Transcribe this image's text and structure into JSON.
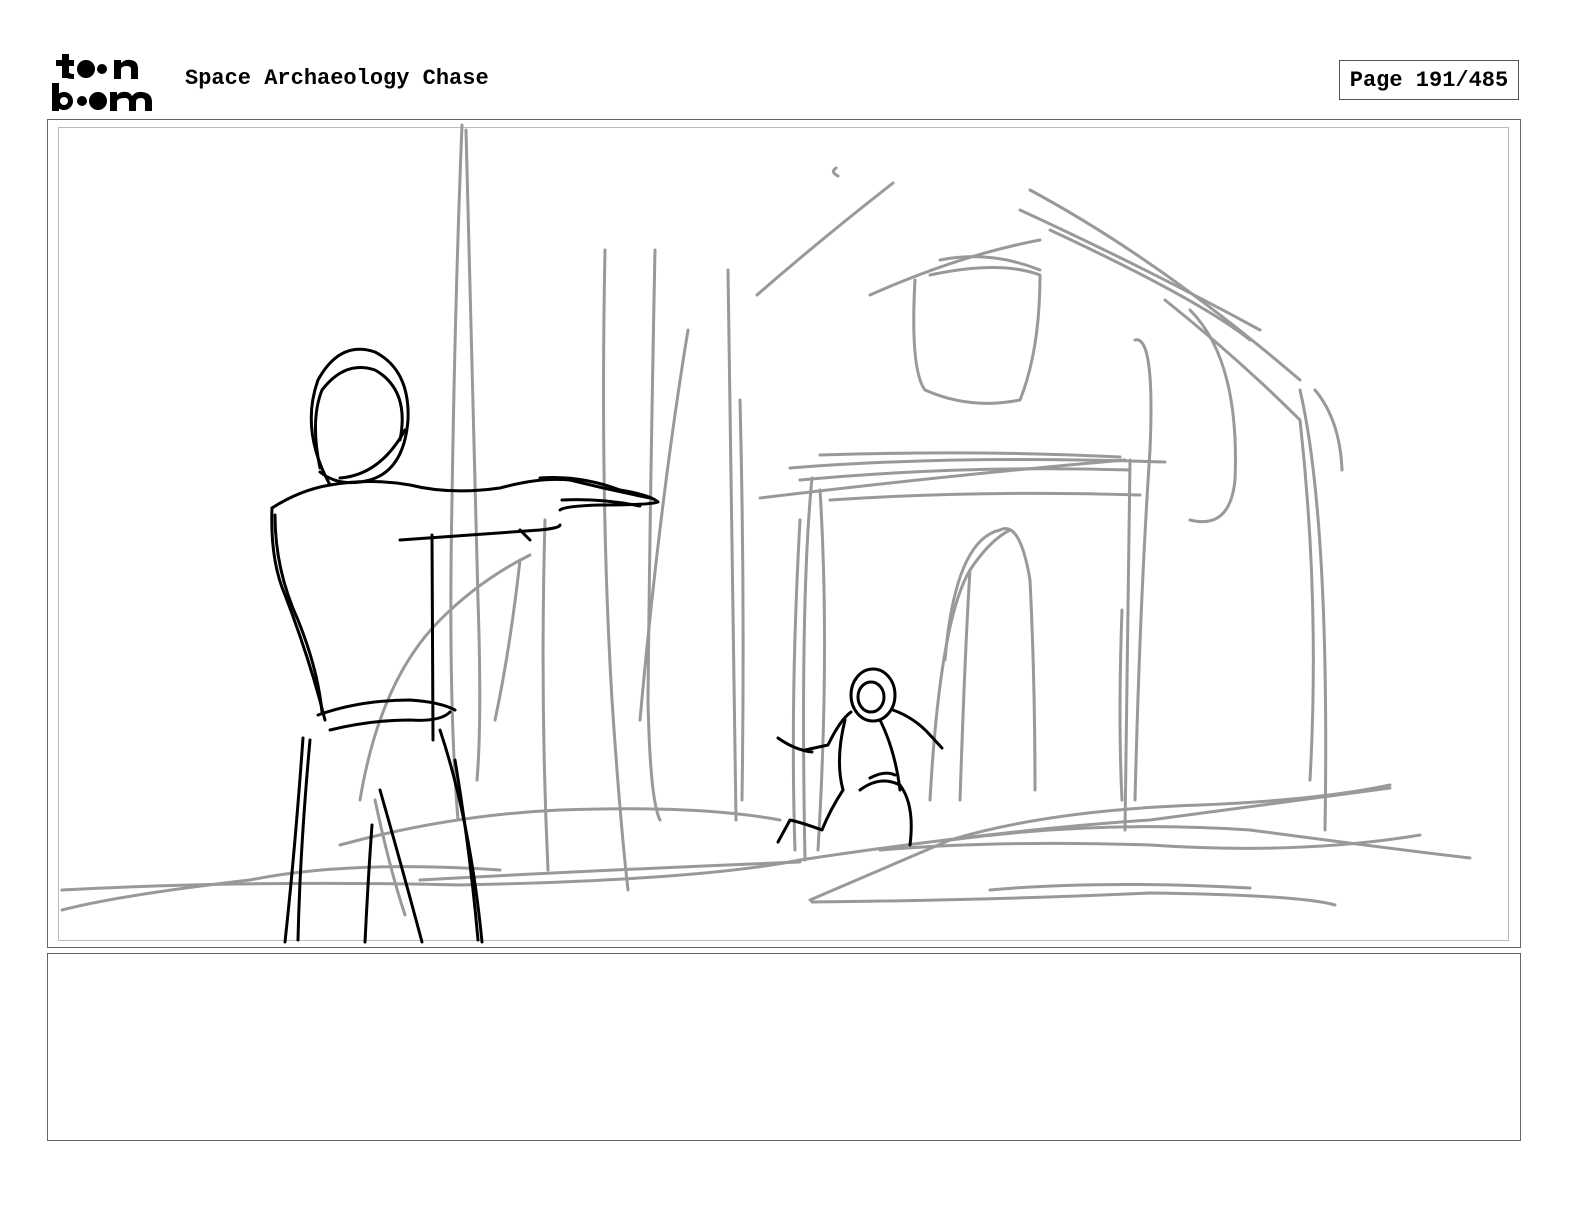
{
  "header": {
    "logo_text": "toon boom",
    "title": "Space Archaeology Chase",
    "page_label": "Page 191/485"
  },
  "panel": {
    "image_description_hidden": ""
  },
  "notes": {
    "text": ""
  }
}
